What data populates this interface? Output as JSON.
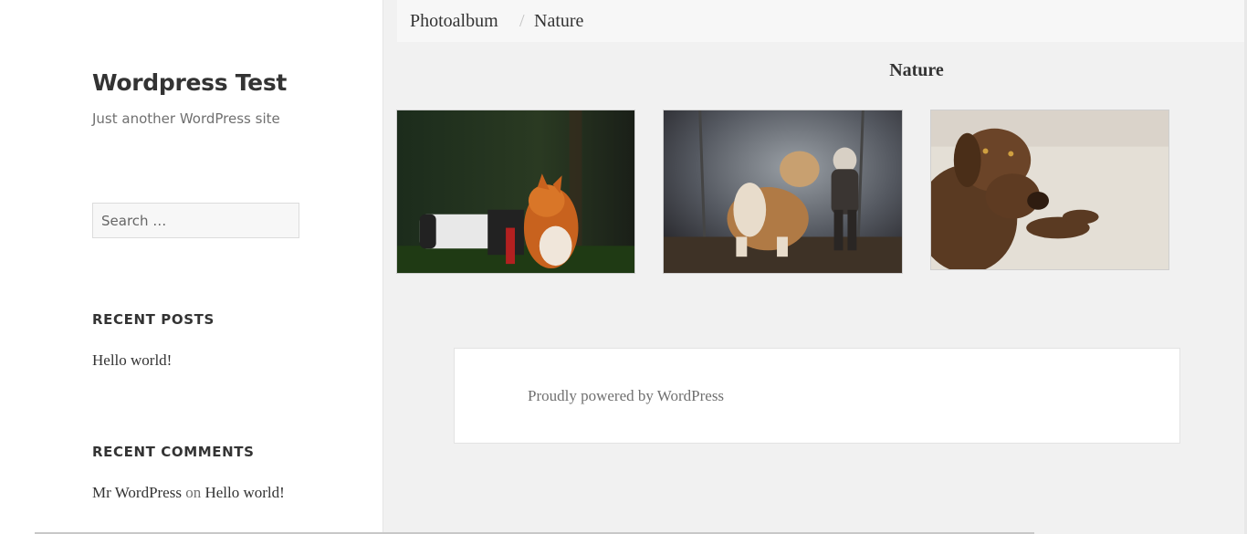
{
  "sidebar": {
    "site_title": "Wordpress Test",
    "site_description": "Just another WordPress site",
    "search": {
      "placeholder": "Search …"
    },
    "recent_posts": {
      "title": "RECENT POSTS",
      "items": [
        "Hello world!"
      ]
    },
    "recent_comments": {
      "title": "RECENT COMMENTS",
      "author": "Mr WordPress",
      "connector": "on",
      "post": "Hello world!"
    }
  },
  "breadcrumb": {
    "items": [
      "Photoalbum",
      "Nature"
    ],
    "separator": "/"
  },
  "album": {
    "title": "Nature",
    "photos": [
      {
        "name": "fox-with-camera-photo"
      },
      {
        "name": "dog-and-child-photo"
      },
      {
        "name": "brown-labrador-photo"
      }
    ]
  },
  "footer": {
    "credit": "Proudly powered by WordPress"
  },
  "colors": {
    "page_background": "#f1f1f1",
    "sidebar_background": "#ffffff",
    "text": "#333333",
    "muted_text": "#707070"
  }
}
